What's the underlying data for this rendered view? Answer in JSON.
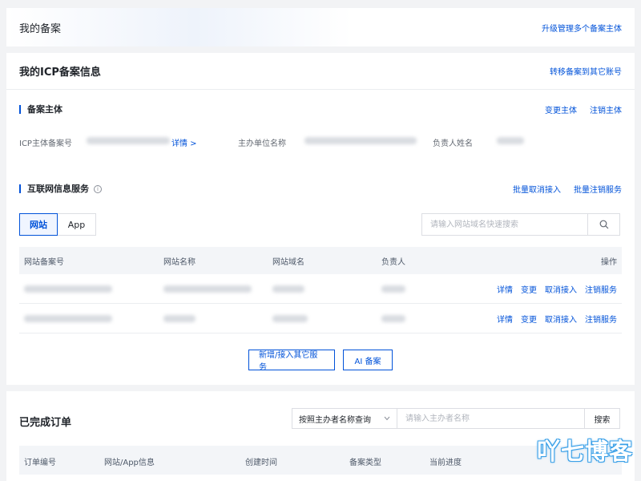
{
  "top": {
    "title": "我的备案",
    "upgrade_link": "升级管理多个备案主体"
  },
  "icp": {
    "title": "我的ICP备案信息",
    "transfer_link": "转移备案到其它账号",
    "subject": {
      "title": "备案主体",
      "change_link": "变更主体",
      "cancel_link": "注销主体",
      "label_number": "ICP主体备案号",
      "detail_link": "详情 >",
      "label_org": "主办单位名称",
      "label_owner": "负责人姓名"
    },
    "services": {
      "title": "互联网信息服务",
      "info_icon": "i",
      "batch_unlink": "批量取消接入",
      "batch_cancel": "批量注销服务",
      "tabs": [
        {
          "label": "网站",
          "active": true
        },
        {
          "label": "App",
          "active": false
        }
      ],
      "search_placeholder": "请输入网站域名快速搜索",
      "columns": [
        "网站备案号",
        "网站名称",
        "网站域名",
        "负责人",
        "操作"
      ],
      "row_actions": [
        "详情",
        "变更",
        "取消接入",
        "注销服务"
      ],
      "add_button": "新增/接入其它服务",
      "ai_button": "AI 备案"
    }
  },
  "orders": {
    "title": "已完成订单",
    "select_value": "按照主办者名称查询",
    "input_placeholder": "请输入主办者名称",
    "search_button": "搜索",
    "columns": [
      "订单编号",
      "网站/App信息",
      "创建时间",
      "备案类型",
      "当前进度"
    ]
  },
  "watermark": "吖七博客",
  "colors": {
    "accent": "#0052d9",
    "background": "#f2f3f5"
  }
}
